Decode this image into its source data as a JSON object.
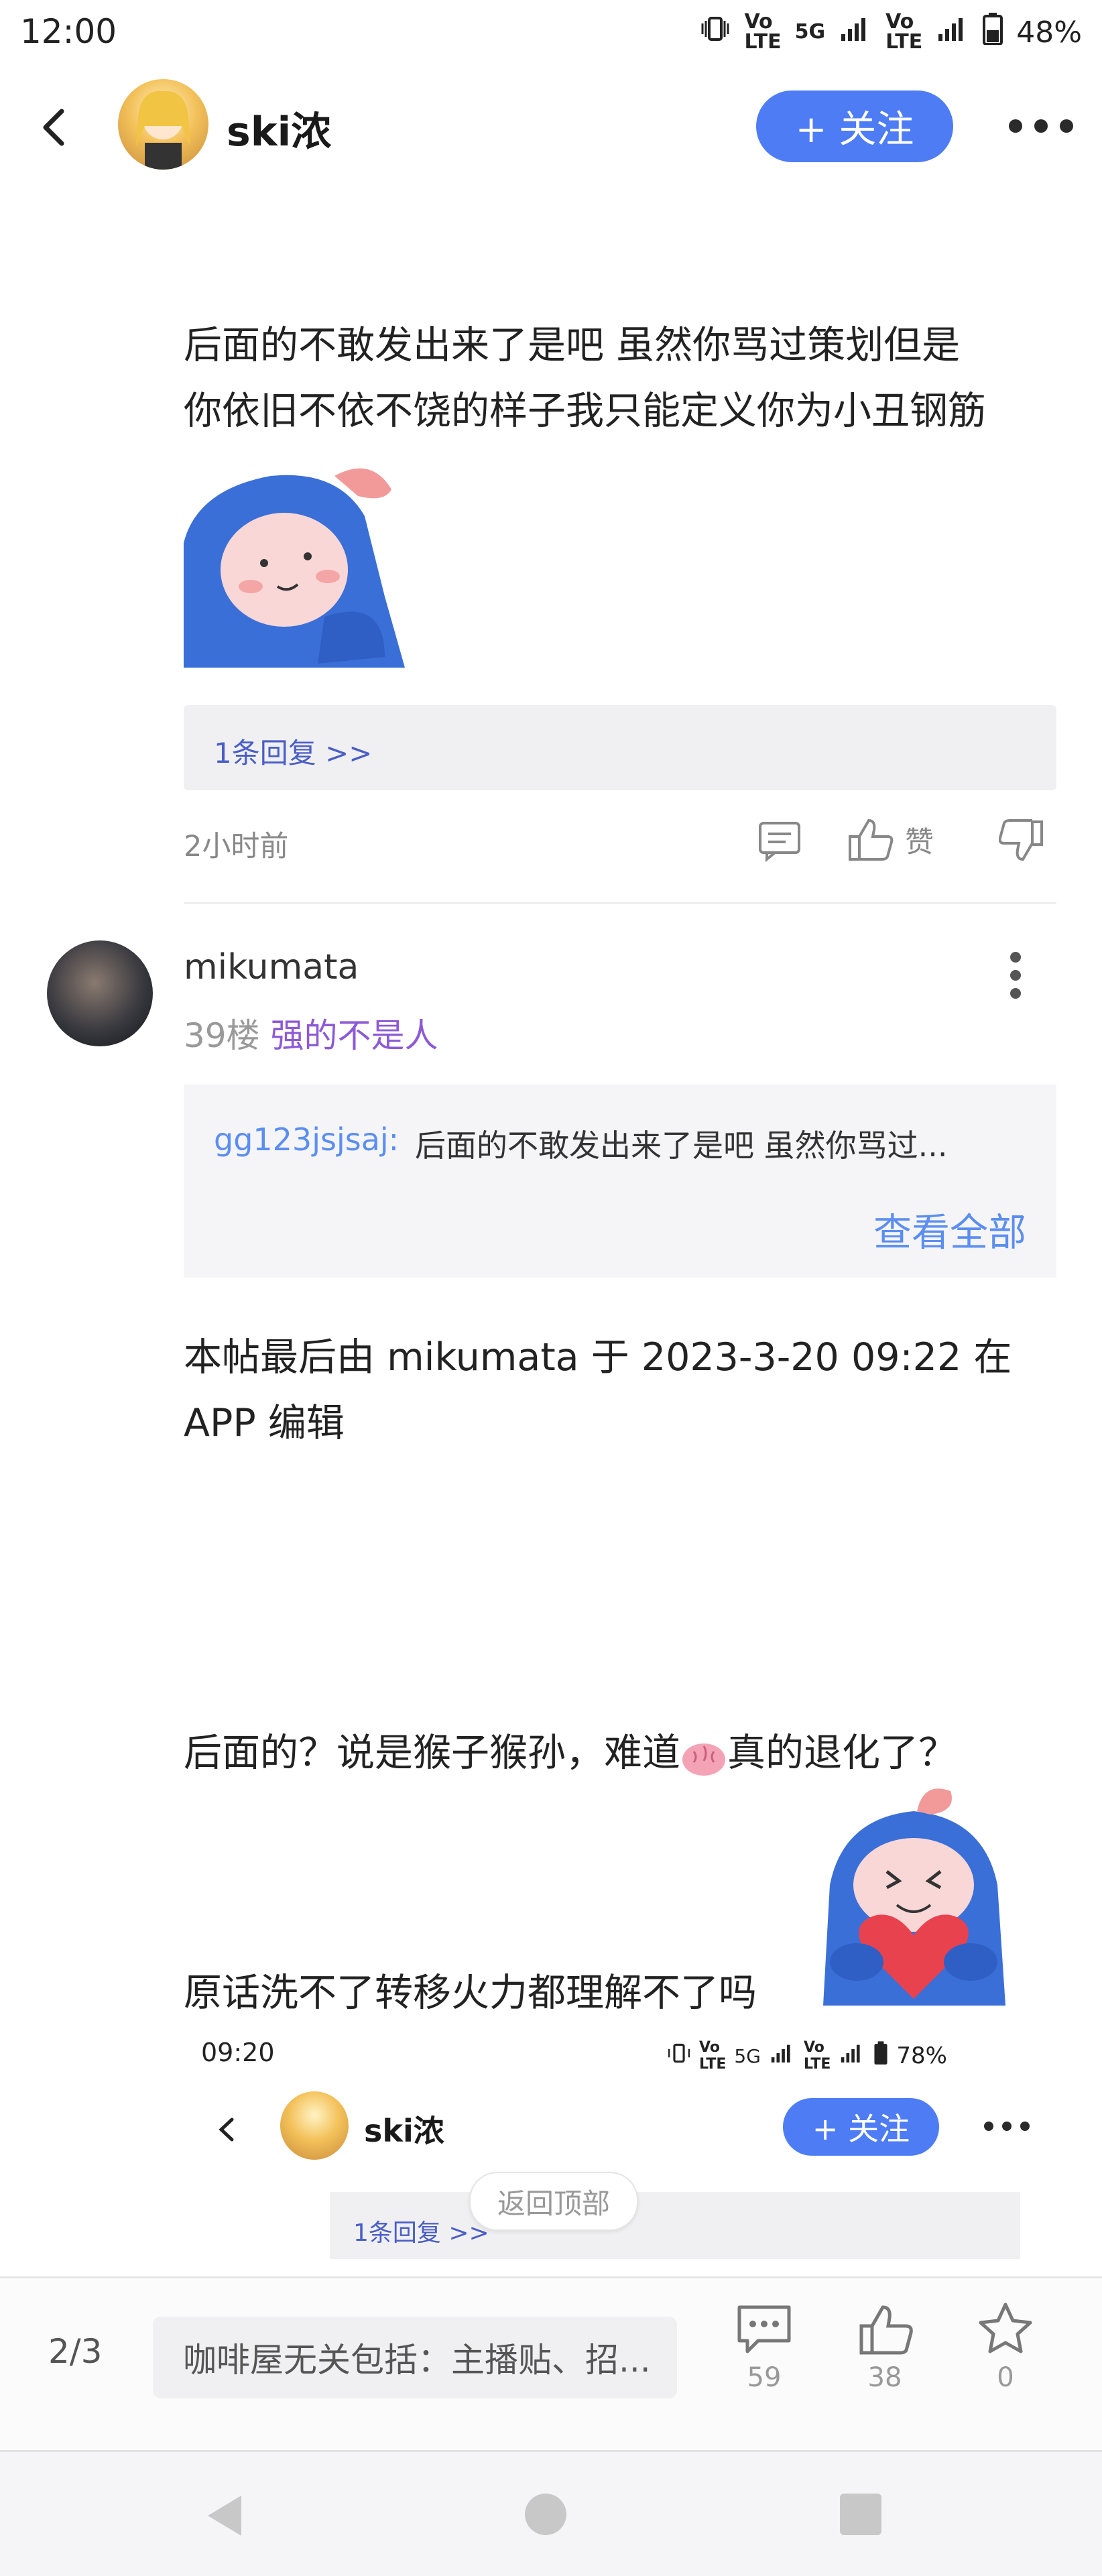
{
  "status_bar": {
    "time": "12:00",
    "network_1": "5G",
    "battery": "48%"
  },
  "header": {
    "username": "ski浓",
    "follow_label": "+ 关注"
  },
  "post": {
    "line1": "后面的不敢发出来了是吧  虽然你骂过策划但是",
    "line2": "你依旧不依不饶的样子我只能定义你为小丑钢筋",
    "reply_link": "1条回复 >>",
    "time": "2小时前",
    "like_label": "赞"
  },
  "comment": {
    "username": "mikumata",
    "floor": "39楼",
    "tag": "强的不是人",
    "quote_author": "gg123jsjsaj:",
    "quote_text": "后面的不敢发出来了是吧  虽然你骂过...",
    "view_all": "查看全部",
    "edit_line1": "本帖最后由 mikumata 于 2023-3-20 09:22 在",
    "edit_line2": "APP 编辑",
    "reply_line1_a": "后面的？说是猴子猴孙，难道",
    "reply_line1_b": "真的退化了？",
    "reply_line2": "原话洗不了转移火力都理解不了吗"
  },
  "embedded": {
    "time": "09:20",
    "network": "5G",
    "battery": "78%",
    "username": "ski浓",
    "follow_label": "+ 关注",
    "reply_link": "1条回复 >>",
    "back_to_top": "返回顶部"
  },
  "bottom_bar": {
    "page_indicator": "2/3",
    "input_text": "咖啡屋无关包括：主播贴、招...",
    "comments_count": "59",
    "likes_count": "38",
    "favorites_count": "0"
  }
}
